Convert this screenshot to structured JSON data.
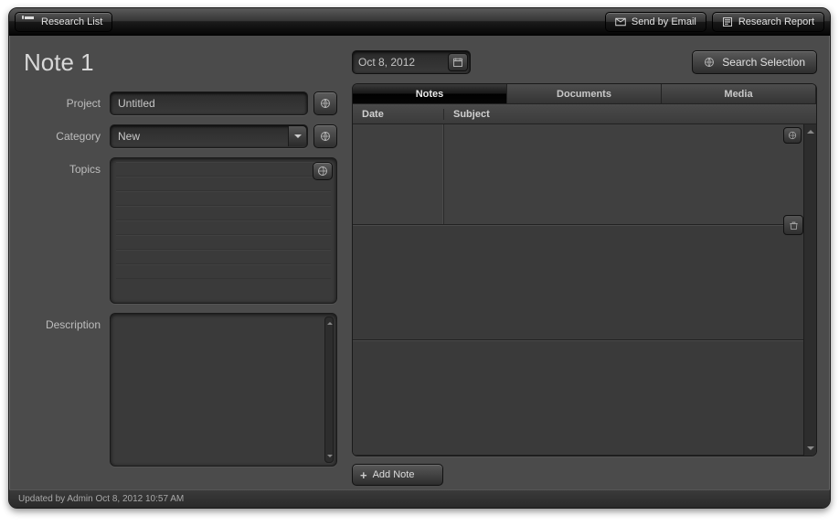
{
  "toolbar": {
    "research_list": "Research List",
    "send_email": "Send by Email",
    "research_report": "Research Report"
  },
  "page": {
    "title": "Note 1"
  },
  "form": {
    "project_label": "Project",
    "project_value": "Untitled",
    "category_label": "Category",
    "category_value": "New",
    "topics_label": "Topics",
    "description_label": "Description"
  },
  "right": {
    "date_value": "Oct 8, 2012",
    "search_selection": "Search Selection",
    "tabs": {
      "notes": "Notes",
      "documents": "Documents",
      "media": "Media"
    },
    "columns": {
      "date": "Date",
      "subject": "Subject"
    },
    "add_note": "Add Note"
  },
  "status": {
    "text": "Updated by Admin Oct 8, 2012 10:57 AM"
  }
}
